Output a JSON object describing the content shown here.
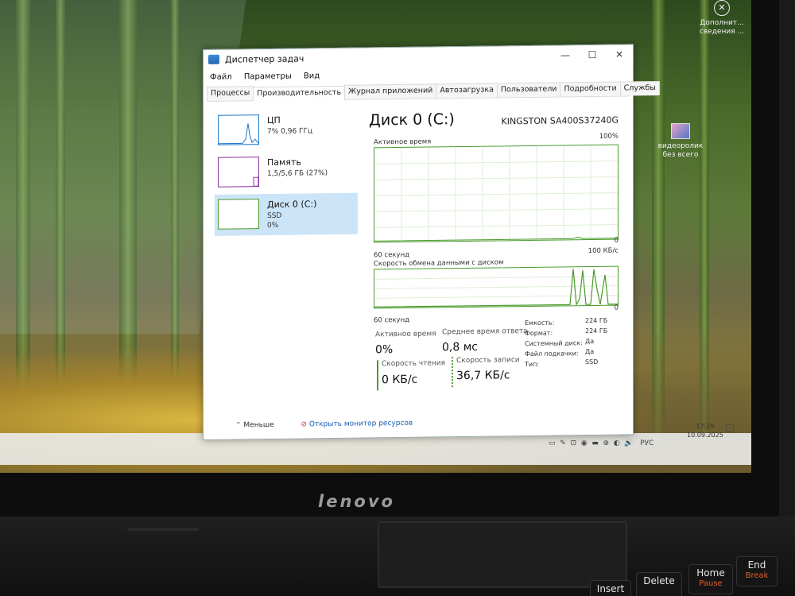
{
  "window": {
    "title": "Диспетчер задач",
    "controls": {
      "minimize": "—",
      "maximize": "☐",
      "close": "✕"
    }
  },
  "menu": [
    "Файл",
    "Параметры",
    "Вид"
  ],
  "tabs": [
    "Процессы",
    "Производительность",
    "Журнал приложений",
    "Автозагрузка",
    "Пользователи",
    "Подробности",
    "Службы"
  ],
  "active_tab": "Производительность",
  "sidebar": {
    "items": [
      {
        "name": "ЦП",
        "line2": "7% 0,96 ГГц",
        "line3": ""
      },
      {
        "name": "Память",
        "line2": "1,5/5,6 ГБ (27%)",
        "line3": ""
      },
      {
        "name": "Диск 0 (C:)",
        "line2": "SSD",
        "line3": "0%"
      }
    ],
    "selected": "Диск 0 (C:)"
  },
  "disk": {
    "title": "Диск 0 (C:)",
    "model": "KINGSTON SA400S37240G",
    "active_time_label": "Активное время",
    "active_time_max": "100%",
    "active_time_min": "0",
    "duration_label_1": "60 секунд",
    "transfer_label": "Скорость обмена данными с диском",
    "transfer_max": "100 КБ/с",
    "transfer_min": "0",
    "duration_label_2": "60 секунд"
  },
  "stats": {
    "active_time": {
      "label": "Активное время",
      "value": "0%"
    },
    "avg_response": {
      "label": "Среднее время ответа",
      "value": "0,8 мс"
    },
    "read_speed": {
      "label": "Скорость чтения",
      "value": "0 КБ/с"
    },
    "write_speed": {
      "label": "Скорость записи",
      "value": "36,7 КБ/с"
    }
  },
  "properties": [
    {
      "key": "Емкость:",
      "value": "224 ГБ"
    },
    {
      "key": "Формат:",
      "value": "224 ГБ"
    },
    {
      "key": "Системный диск:",
      "value": "Да"
    },
    {
      "key": "Файл подкачки:",
      "value": "Да"
    },
    {
      "key": "Тип:",
      "value": "SSD"
    }
  ],
  "footer": {
    "less": "Меньше",
    "monitor": "Открыть монитор ресурсов"
  },
  "desktop": {
    "notif_label": "Дополнит... сведения ...",
    "video_label": "видеоролик без всего"
  },
  "tray": {
    "lang": "РУС",
    "time": "17:29",
    "date": "10.09.2025"
  },
  "laptop": {
    "brand": "lenovo",
    "keys": [
      {
        "main": "Insert",
        "sub": ""
      },
      {
        "main": "Delete",
        "sub": ""
      },
      {
        "main": "Home",
        "sub": "Pause"
      },
      {
        "main": "End",
        "sub": "Break"
      }
    ]
  },
  "colors": {
    "disk_accent": "#4a9b2c",
    "cpu_accent": "#1b76c9",
    "memory_accent": "#8b2fa3",
    "selected_bg": "#cce4f7",
    "link": "#1b5fb5"
  }
}
